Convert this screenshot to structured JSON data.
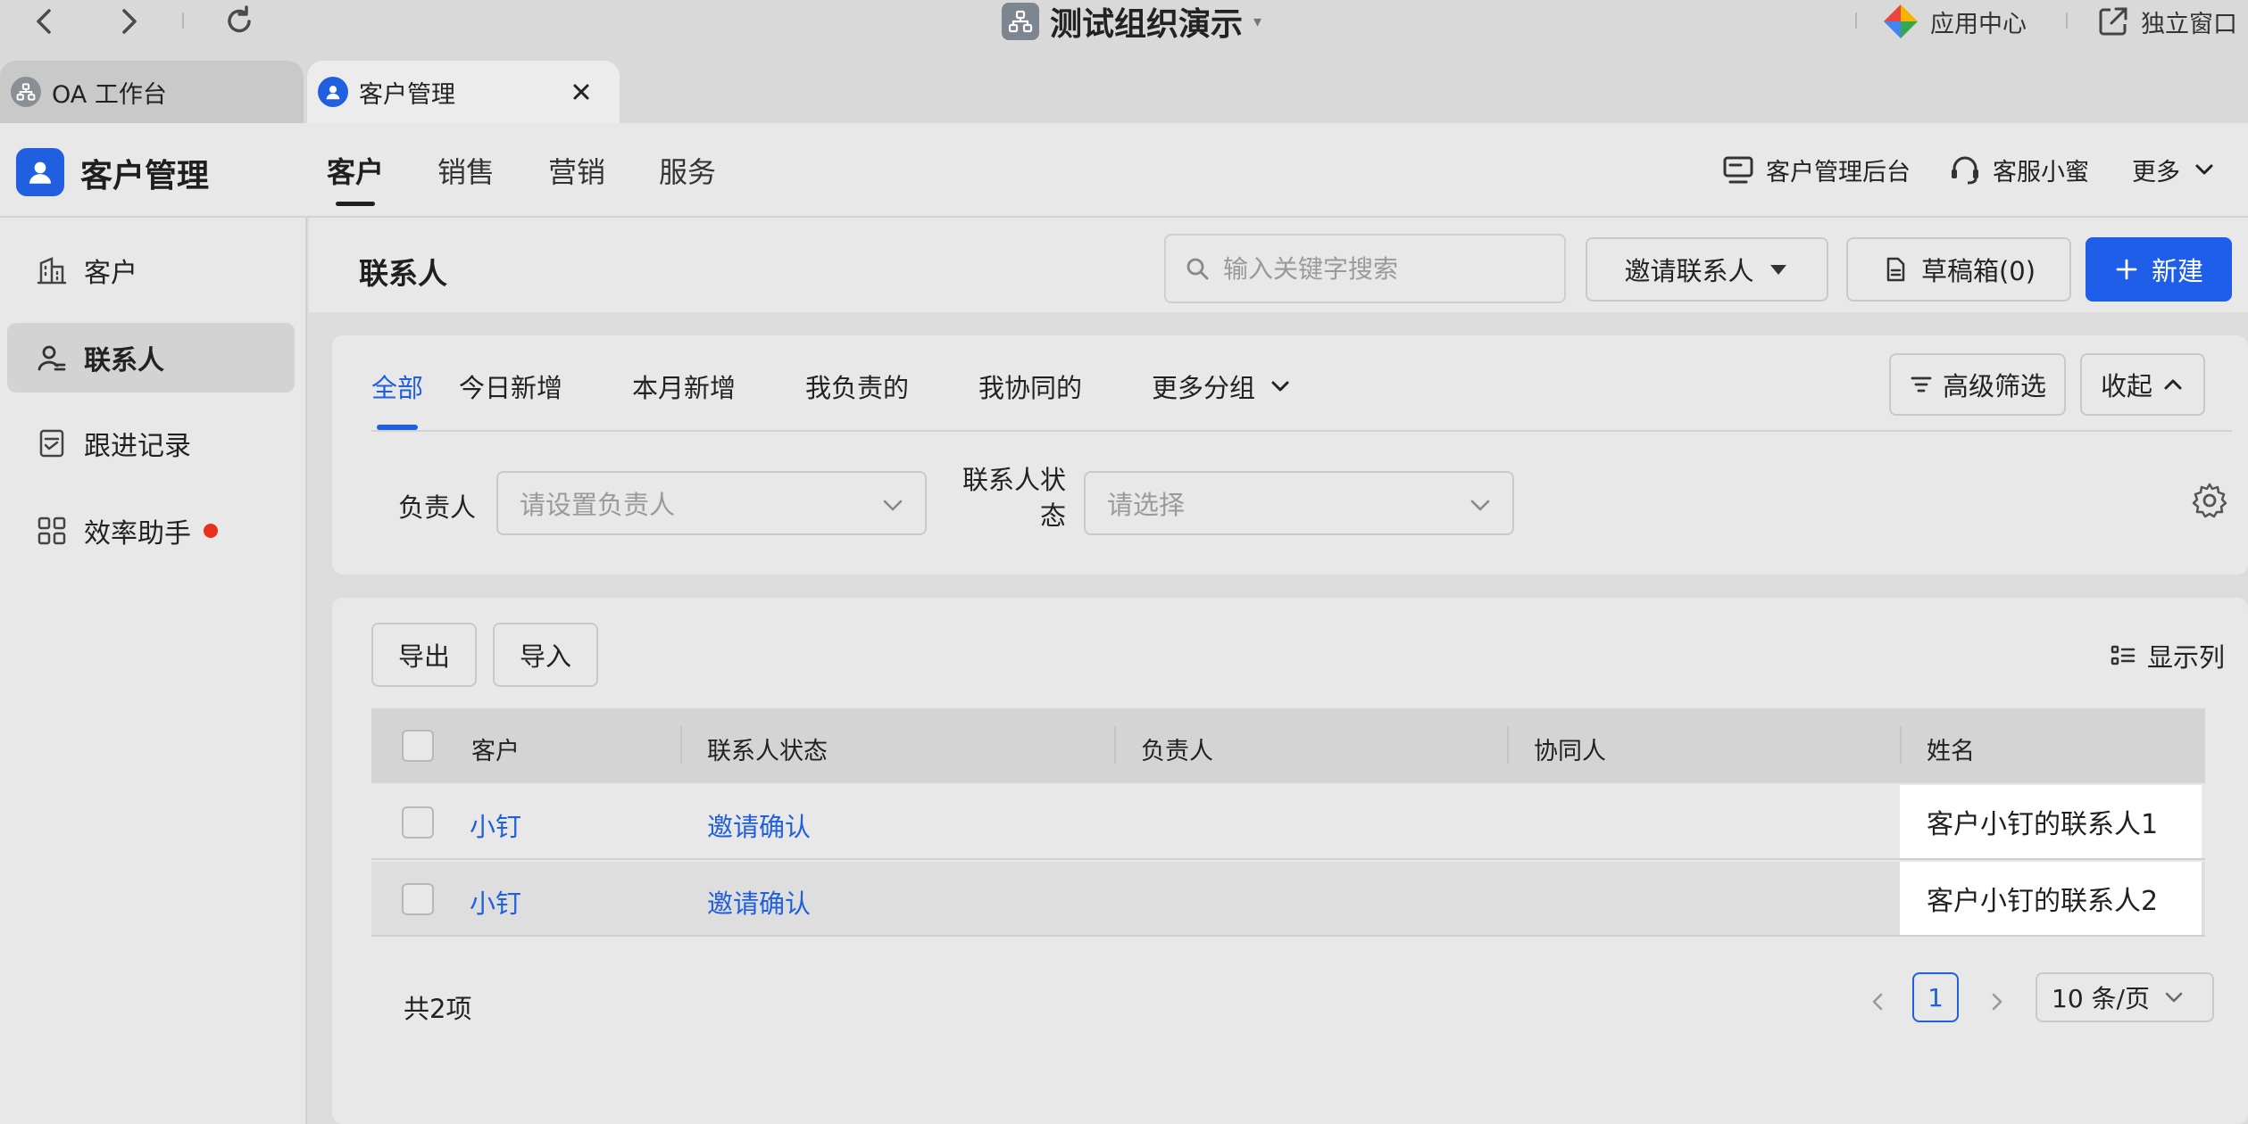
{
  "titlebar": {
    "org_name": "测试组织演示",
    "org_caret": "▾",
    "app_center": "应用中心",
    "standalone_window": "独立窗口"
  },
  "tabs": [
    {
      "label": "OA 工作台"
    },
    {
      "label": "客户管理"
    }
  ],
  "app": {
    "title": "客户管理",
    "top_nav": [
      {
        "label": "客户"
      },
      {
        "label": "销售"
      },
      {
        "label": "营销"
      },
      {
        "label": "服务"
      }
    ],
    "admin_link": "客户管理后台",
    "service_link": "客服小蜜",
    "more_link": "更多"
  },
  "sidebar": {
    "items": [
      {
        "label": "客户"
      },
      {
        "label": "联系人"
      },
      {
        "label": "跟进记录"
      },
      {
        "label": "效率助手"
      }
    ]
  },
  "page": {
    "title": "联系人",
    "search_placeholder": "输入关键字搜索",
    "invite_button": "邀请联系人",
    "drafts_button": "草稿箱(0)",
    "new_button": "新建"
  },
  "filters": {
    "tabs": [
      {
        "label": "全部"
      },
      {
        "label": "今日新增"
      },
      {
        "label": "本月新增"
      },
      {
        "label": "我负责的"
      },
      {
        "label": "我协同的"
      },
      {
        "label": "更多分组"
      }
    ],
    "advanced_button": "高级筛选",
    "collapse_button": "收起",
    "owner_label": "负责人",
    "owner_placeholder": "请设置负责人",
    "status_label_line1": "联系人状",
    "status_label_line2": "态",
    "status_placeholder": "请选择"
  },
  "table": {
    "export_button": "导出",
    "import_button": "导入",
    "show_columns": "显示列",
    "columns": [
      "客户",
      "联系人状态",
      "负责人",
      "协同人",
      "姓名"
    ],
    "rows": [
      {
        "customer": "小钉",
        "status": "邀请确认",
        "owner": "",
        "collaborator": "",
        "name": "客户小钉的联系人1"
      },
      {
        "customer": "小钉",
        "status": "邀请确认",
        "owner": "",
        "collaborator": "",
        "name": "客户小钉的联系人2"
      }
    ],
    "total": "共2项",
    "current_page": "1",
    "page_size": "10 条/页"
  },
  "colors": {
    "accent": "#1f5fe0",
    "badge_red": "#e8301c"
  }
}
